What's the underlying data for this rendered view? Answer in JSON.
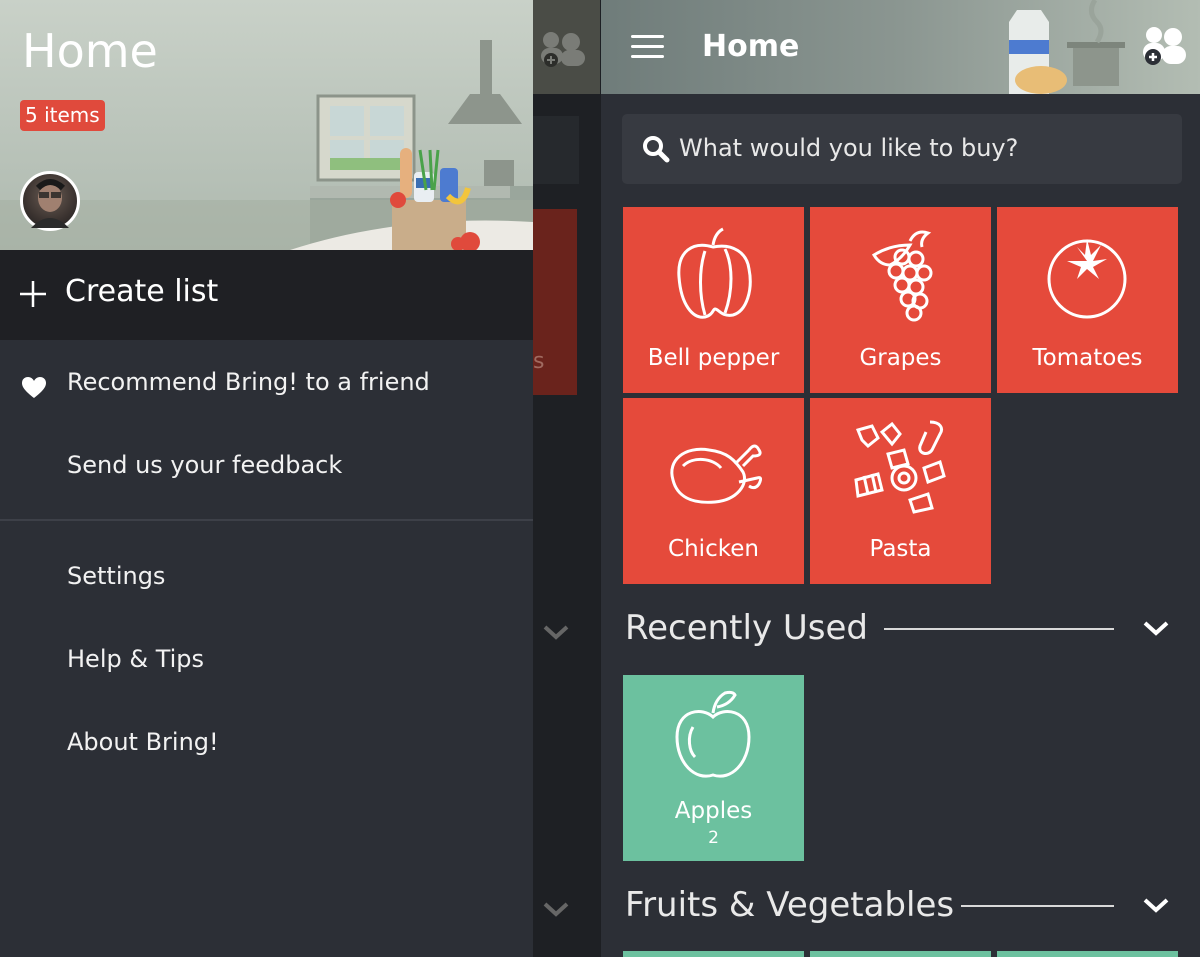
{
  "drawer": {
    "title": "Home",
    "items_badge": "5 items",
    "create_list_label": "Create list",
    "menu_primary": [
      {
        "label": "Recommend Bring! to a friend",
        "icon": "heart-icon"
      },
      {
        "label": "Send us your feedback"
      }
    ],
    "menu_secondary": [
      {
        "label": "Settings"
      },
      {
        "label": "Help & Tips"
      },
      {
        "label": "About Bring!"
      }
    ]
  },
  "app": {
    "title": "Home",
    "search_placeholder": "What would you like to buy?",
    "list_tiles": [
      {
        "label": "Bell pepper",
        "icon": "bell-pepper-icon"
      },
      {
        "label": "Grapes",
        "icon": "grapes-icon"
      },
      {
        "label": "Tomatoes",
        "icon": "tomato-icon"
      },
      {
        "label": "Chicken",
        "icon": "chicken-icon"
      },
      {
        "label": "Pasta",
        "icon": "pasta-icon"
      }
    ],
    "recently_used_title": "Recently Used",
    "recent_tiles": [
      {
        "label": "Apples",
        "count": "2",
        "icon": "apple-icon"
      }
    ],
    "fruits_title": "Fruits & Vegetables"
  },
  "colors": {
    "accent_red": "#e54a3b",
    "accent_green": "#6cc19f",
    "background": "#2c2f36",
    "badge_red": "#e04a3c"
  }
}
